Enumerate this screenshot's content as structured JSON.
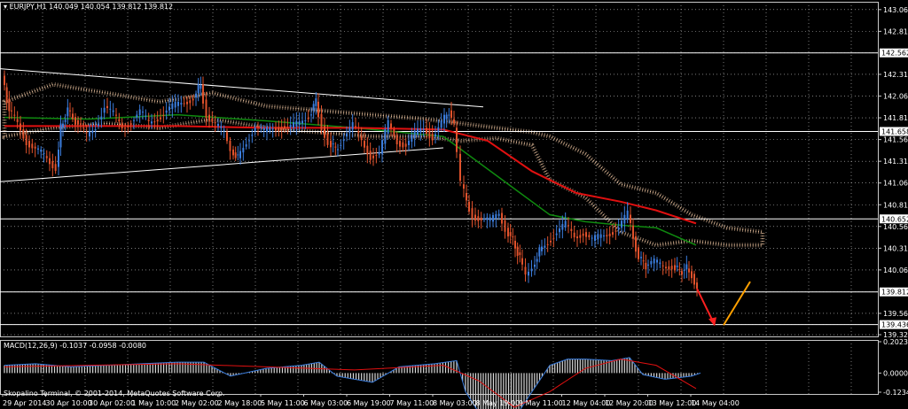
{
  "header": {
    "symbol": "EURJPY,H1",
    "ohlc": "140.049 140.054 139.812 139.812"
  },
  "macd": {
    "label": "MACD(12,26,9) -0.1037 -0.0958 -0.0080",
    "levels": [
      "0.2023",
      "0.0000",
      "-0.1234"
    ]
  },
  "copyright": "Skopalino Terminal, © 2001-2014, MetaQuotes Software Corp.",
  "colors": {
    "background": "#000000",
    "grid": "#c8c8c8",
    "bull": "#3b7ddd",
    "bear": "#e0522c",
    "ma_slow": "#e01010",
    "ma_fast": "#0f8a0f",
    "cloud": "#f2c9a4",
    "macd_hist": "#d8d8d8",
    "macd_main": "#3b7ddd",
    "macd_signal": "#e01010",
    "forecast_down": "#ff2020",
    "forecast_up": "#ffa000"
  },
  "chart_data": {
    "type": "candlestick",
    "symbol": "EURJPY",
    "timeframe": "H1",
    "ylim": [
      139.3,
      143.15
    ],
    "y_ticks": [
      "143.060",
      "142.810",
      "142.562",
      "142.315",
      "142.065",
      "141.815",
      "141.658",
      "141.565",
      "141.315",
      "141.065",
      "140.815",
      "140.652",
      "140.565",
      "140.315",
      "140.065",
      "139.812",
      "139.565",
      "139.436",
      "139.320"
    ],
    "x_ticks": [
      "29 Apr 2014",
      "30 Apr 10:00",
      "30 Apr 02:00",
      "1 May 10:00",
      "2 May 02:00",
      "2 May 18:00",
      "5 May 11:00",
      "6 May 03:00",
      "6 May 19:00",
      "7 May 11:00",
      "8 May 03:00",
      "8 May 19:00",
      "9 May 11:00",
      "12 May 04:00",
      "12 May 20:00",
      "13 May 12:00",
      "14 May 04:00"
    ],
    "horizontal_levels": [
      {
        "value": 142.562,
        "label": "142.562"
      },
      {
        "value": 141.658,
        "label": "141.658"
      },
      {
        "value": 140.652,
        "label": "140.652"
      },
      {
        "value": 139.812,
        "label": "139.812"
      },
      {
        "value": 139.436,
        "label": "139.436"
      }
    ],
    "trendlines": [
      {
        "t1": 0,
        "p1": 142.38,
        "t2": 545,
        "p2": 141.94
      },
      {
        "t1": 0,
        "p1": 141.08,
        "t2": 500,
        "p2": 141.47
      }
    ],
    "price_path": [
      [
        4,
        142.3
      ],
      [
        12,
        141.9
      ],
      [
        22,
        141.75
      ],
      [
        32,
        141.55
      ],
      [
        42,
        141.45
      ],
      [
        55,
        141.35
      ],
      [
        65,
        141.25
      ],
      [
        70,
        141.7
      ],
      [
        78,
        141.9
      ],
      [
        90,
        141.75
      ],
      [
        100,
        141.6
      ],
      [
        110,
        141.72
      ],
      [
        120,
        141.95
      ],
      [
        130,
        141.85
      ],
      [
        140,
        141.7
      ],
      [
        150,
        141.78
      ],
      [
        160,
        141.88
      ],
      [
        170,
        141.75
      ],
      [
        180,
        141.82
      ],
      [
        190,
        141.9
      ],
      [
        200,
        141.95
      ],
      [
        210,
        142.0
      ],
      [
        220,
        142.05
      ],
      [
        228,
        142.2
      ],
      [
        235,
        141.85
      ],
      [
        245,
        141.72
      ],
      [
        255,
        141.65
      ],
      [
        262,
        141.45
      ],
      [
        270,
        141.35
      ],
      [
        280,
        141.55
      ],
      [
        290,
        141.72
      ],
      [
        300,
        141.65
      ],
      [
        310,
        141.7
      ],
      [
        320,
        141.72
      ],
      [
        330,
        141.7
      ],
      [
        340,
        141.75
      ],
      [
        350,
        141.85
      ],
      [
        358,
        142.0
      ],
      [
        365,
        141.72
      ],
      [
        372,
        141.55
      ],
      [
        380,
        141.45
      ],
      [
        390,
        141.6
      ],
      [
        400,
        141.72
      ],
      [
        410,
        141.55
      ],
      [
        420,
        141.38
      ],
      [
        430,
        141.4
      ],
      [
        440,
        141.75
      ],
      [
        450,
        141.55
      ],
      [
        460,
        141.5
      ],
      [
        470,
        141.62
      ],
      [
        480,
        141.7
      ],
      [
        490,
        141.6
      ],
      [
        500,
        141.75
      ],
      [
        508,
        141.9
      ],
      [
        514,
        141.7
      ],
      [
        518,
        141.4
      ],
      [
        522,
        141.05
      ],
      [
        528,
        140.85
      ],
      [
        535,
        140.7
      ],
      [
        545,
        140.65
      ],
      [
        555,
        140.62
      ],
      [
        565,
        140.72
      ],
      [
        572,
        140.55
      ],
      [
        580,
        140.4
      ],
      [
        588,
        140.2
      ],
      [
        595,
        140.0
      ],
      [
        602,
        140.1
      ],
      [
        610,
        140.28
      ],
      [
        620,
        140.4
      ],
      [
        630,
        140.5
      ],
      [
        640,
        140.58
      ],
      [
        650,
        140.45
      ],
      [
        660,
        140.5
      ],
      [
        670,
        140.4
      ],
      [
        680,
        140.45
      ],
      [
        690,
        140.5
      ],
      [
        700,
        140.55
      ],
      [
        710,
        140.7
      ],
      [
        716,
        140.45
      ],
      [
        722,
        140.2
      ],
      [
        730,
        140.12
      ],
      [
        740,
        140.15
      ],
      [
        750,
        140.1
      ],
      [
        760,
        140.12
      ],
      [
        768,
        140.05
      ],
      [
        776,
        140.08
      ],
      [
        782,
        140.02
      ],
      [
        788,
        139.82
      ]
    ],
    "ma_slow": [
      [
        5,
        141.72
      ],
      [
        100,
        141.72
      ],
      [
        200,
        141.72
      ],
      [
        300,
        141.7
      ],
      [
        400,
        141.7
      ],
      [
        500,
        141.68
      ],
      [
        550,
        141.55
      ],
      [
        600,
        141.2
      ],
      [
        650,
        140.95
      ],
      [
        700,
        140.85
      ],
      [
        740,
        140.75
      ],
      [
        785,
        140.6
      ]
    ],
    "ma_fast": [
      [
        5,
        141.82
      ],
      [
        100,
        141.8
      ],
      [
        200,
        141.85
      ],
      [
        300,
        141.78
      ],
      [
        400,
        141.7
      ],
      [
        500,
        141.6
      ],
      [
        540,
        141.3
      ],
      [
        580,
        141.0
      ],
      [
        620,
        140.7
      ],
      [
        660,
        140.62
      ],
      [
        700,
        140.58
      ],
      [
        740,
        140.55
      ],
      [
        785,
        140.35
      ]
    ],
    "cloud": [
      [
        5,
        141.6,
        142.0
      ],
      [
        60,
        141.7,
        142.2
      ],
      [
        120,
        141.75,
        142.1
      ],
      [
        180,
        141.7,
        142.0
      ],
      [
        240,
        141.8,
        142.1
      ],
      [
        300,
        141.7,
        141.95
      ],
      [
        360,
        141.65,
        141.9
      ],
      [
        420,
        141.6,
        141.85
      ],
      [
        480,
        141.6,
        141.8
      ],
      [
        520,
        141.55,
        141.75
      ],
      [
        560,
        141.58,
        141.7
      ],
      [
        600,
        141.5,
        141.65
      ],
      [
        620,
        141.1,
        141.6
      ],
      [
        660,
        140.9,
        141.4
      ],
      [
        700,
        140.5,
        141.05
      ],
      [
        740,
        140.35,
        140.95
      ],
      [
        780,
        140.4,
        140.7
      ],
      [
        820,
        140.35,
        140.55
      ],
      [
        860,
        140.35,
        140.5
      ]
    ],
    "forecast_down": [
      [
        786,
        139.85
      ],
      [
        806,
        139.43
      ]
    ],
    "forecast_up": [
      [
        816,
        139.43
      ],
      [
        846,
        139.93
      ]
    ],
    "macd_hist": [
      [
        5,
        0.05
      ],
      [
        40,
        0.06
      ],
      [
        80,
        0.04
      ],
      [
        120,
        0.05
      ],
      [
        160,
        0.06
      ],
      [
        200,
        0.07
      ],
      [
        230,
        0.07
      ],
      [
        260,
        -0.02
      ],
      [
        300,
        0.03
      ],
      [
        340,
        0.05
      ],
      [
        360,
        0.07
      ],
      [
        380,
        -0.02
      ],
      [
        420,
        -0.06
      ],
      [
        450,
        0.04
      ],
      [
        490,
        0.06
      ],
      [
        515,
        0.08
      ],
      [
        525,
        -0.12
      ],
      [
        545,
        -0.3
      ],
      [
        565,
        -0.3
      ],
      [
        585,
        -0.25
      ],
      [
        600,
        -0.12
      ],
      [
        620,
        0.05
      ],
      [
        640,
        0.09
      ],
      [
        660,
        0.09
      ],
      [
        690,
        0.08
      ],
      [
        710,
        0.1
      ],
      [
        725,
        -0.01
      ],
      [
        750,
        -0.04
      ],
      [
        780,
        -0.02
      ],
      [
        790,
        0.0
      ]
    ],
    "macd_signal": [
      [
        5,
        0.04
      ],
      [
        100,
        0.05
      ],
      [
        200,
        0.06
      ],
      [
        300,
        0.04
      ],
      [
        400,
        0.02
      ],
      [
        500,
        0.05
      ],
      [
        540,
        -0.05
      ],
      [
        580,
        -0.22
      ],
      [
        620,
        -0.12
      ],
      [
        660,
        0.03
      ],
      [
        700,
        0.09
      ],
      [
        740,
        0.05
      ],
      [
        785,
        -0.1
      ]
    ]
  }
}
